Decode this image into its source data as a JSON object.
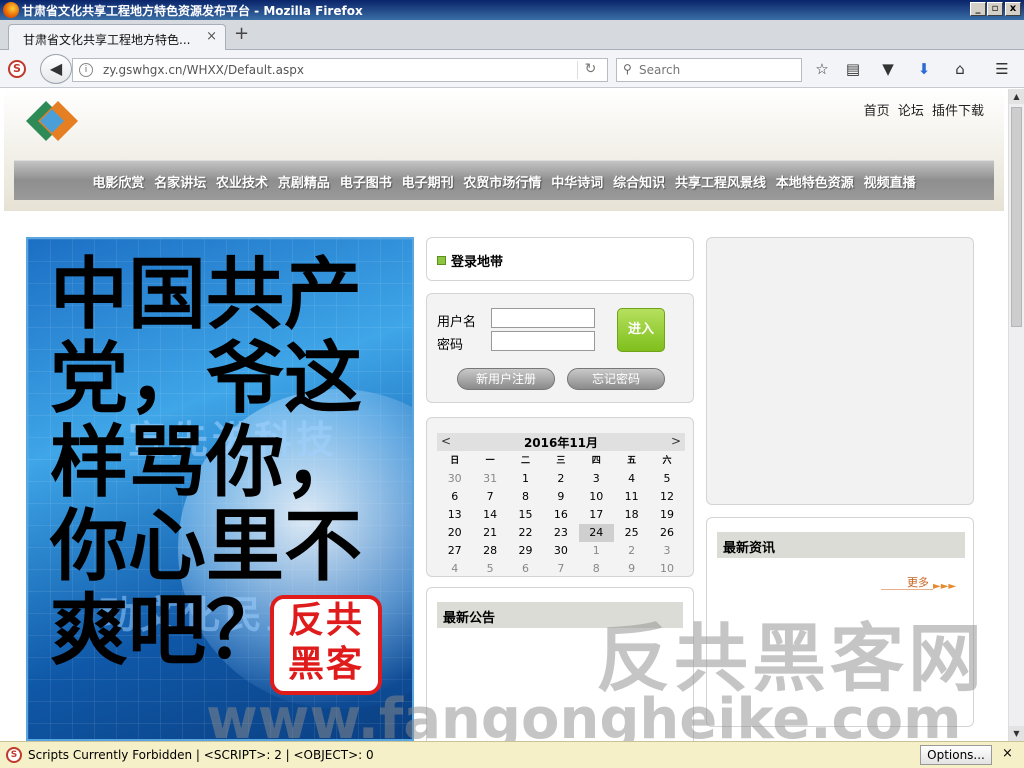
{
  "window": {
    "title": "甘肃省文化共享工程地方特色资源发布平台 - Mozilla Firefox",
    "min": "_",
    "max": "▫",
    "close": "x"
  },
  "tab": {
    "title": "甘肃省文化共享工程地方特色...",
    "close": "×",
    "new": "+"
  },
  "nav": {
    "url": "zy.gswhgx.cn/WHXX/Default.aspx",
    "search_placeholder": "Search"
  },
  "site": {
    "toplinks": [
      "首页",
      "论坛",
      "插件下载"
    ],
    "menu": [
      "电影欣赏",
      "名家讲坛",
      "农业技术",
      "京剧精品",
      "电子图书",
      "电子期刊",
      "农贸市场行情",
      "中华诗词",
      "综合知识",
      "共享工程风景线",
      "本地特色资源",
      "视频直播"
    ]
  },
  "banner": {
    "bg_line1": "宣先进科技",
    "bg_line2": "动文化民主"
  },
  "login": {
    "title": "登录地带",
    "username_label": "用户名",
    "password_label": "密码",
    "enter": "进入",
    "register": "新用户注册",
    "forgot": "忘记密码"
  },
  "calendar": {
    "prev": "<",
    "next": ">",
    "month": "2016年11月",
    "dow": [
      "日",
      "一",
      "二",
      "三",
      "四",
      "五",
      "六"
    ],
    "weeks": [
      [
        "30",
        "31",
        "1",
        "2",
        "3",
        "4",
        "5"
      ],
      [
        "6",
        "7",
        "8",
        "9",
        "10",
        "11",
        "12"
      ],
      [
        "13",
        "14",
        "15",
        "16",
        "17",
        "18",
        "19"
      ],
      [
        "20",
        "21",
        "22",
        "23",
        "24",
        "25",
        "26"
      ],
      [
        "27",
        "28",
        "29",
        "30",
        "1",
        "2",
        "3"
      ],
      [
        "4",
        "5",
        "6",
        "7",
        "8",
        "9",
        "10"
      ]
    ],
    "today": "24"
  },
  "notice": {
    "title": "最新公告"
  },
  "news": {
    "title": "最新资讯",
    "more": "更多"
  },
  "overlay": {
    "lines": [
      "中国共产",
      "党，爷这",
      "样骂你，",
      "你心里不",
      "爽吧？"
    ],
    "stamp_line1": "反共",
    "stamp_line2": "黑客",
    "watermark_cn": "反共黑客网",
    "watermark_en": "www.fangongheike.com"
  },
  "statusbar": {
    "message": "Scripts Currently Forbidden | <SCRIPT>: 2 | <OBJECT>: 0",
    "options": "Options...",
    "close": "×"
  },
  "colors": {
    "nav_bar": "#9a9a9a",
    "enter_button": "#8cc63f",
    "stamp_red": "#e01b1b",
    "banner_blue": "#1c6fc4"
  }
}
